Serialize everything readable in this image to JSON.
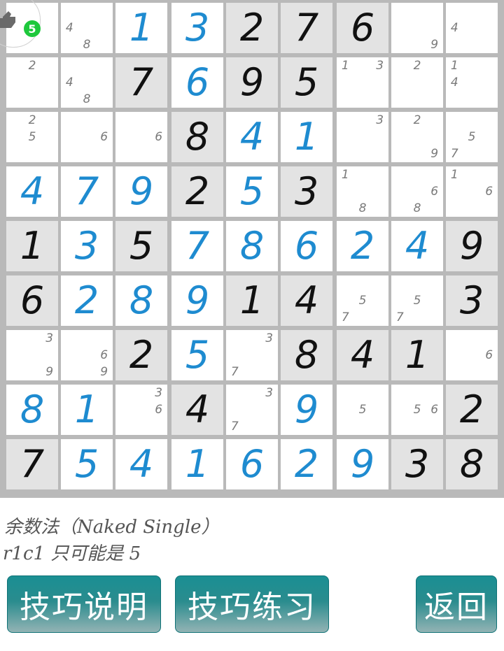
{
  "board": {
    "rows": [
      [
        {
          "v": "",
          "c": [],
          "g": false
        },
        {
          "v": "",
          "c": [
            "4",
            "8"
          ],
          "g": false
        },
        {
          "v": "1",
          "c": [],
          "g": false
        },
        {
          "v": "3",
          "c": [],
          "g": false
        },
        {
          "v": "2",
          "c": [],
          "g": true
        },
        {
          "v": "7",
          "c": [],
          "g": true
        },
        {
          "v": "6",
          "c": [],
          "g": true
        },
        {
          "v": "",
          "c": [
            "9"
          ],
          "g": false
        },
        {
          "v": "",
          "c": [
            "4"
          ],
          "g": false
        }
      ],
      [
        {
          "v": "",
          "c": [
            "2"
          ],
          "g": false
        },
        {
          "v": "",
          "c": [
            "4",
            "8"
          ],
          "g": false
        },
        {
          "v": "7",
          "c": [],
          "g": true
        },
        {
          "v": "6",
          "c": [],
          "g": false
        },
        {
          "v": "9",
          "c": [],
          "g": true
        },
        {
          "v": "5",
          "c": [],
          "g": true
        },
        {
          "v": "",
          "c": [
            "1",
            "3"
          ],
          "g": false
        },
        {
          "v": "",
          "c": [
            "2"
          ],
          "g": false
        },
        {
          "v": "",
          "c": [
            "1",
            "4"
          ],
          "g": false
        }
      ],
      [
        {
          "v": "",
          "c": [
            "2",
            "5"
          ],
          "g": false
        },
        {
          "v": "",
          "c": [
            "6"
          ],
          "g": false
        },
        {
          "v": "",
          "c": [
            "6"
          ],
          "g": false
        },
        {
          "v": "8",
          "c": [],
          "g": true
        },
        {
          "v": "4",
          "c": [],
          "g": false
        },
        {
          "v": "1",
          "c": [],
          "g": false
        },
        {
          "v": "",
          "c": [
            "3"
          ],
          "g": false
        },
        {
          "v": "",
          "c": [
            "2",
            "9"
          ],
          "g": false
        },
        {
          "v": "",
          "c": [
            "5",
            "7"
          ],
          "g": false
        }
      ],
      [
        {
          "v": "4",
          "c": [],
          "g": false
        },
        {
          "v": "7",
          "c": [],
          "g": false
        },
        {
          "v": "9",
          "c": [],
          "g": false
        },
        {
          "v": "2",
          "c": [],
          "g": true
        },
        {
          "v": "5",
          "c": [],
          "g": false
        },
        {
          "v": "3",
          "c": [],
          "g": true
        },
        {
          "v": "",
          "c": [
            "1",
            "8"
          ],
          "g": false
        },
        {
          "v": "",
          "c": [
            "6",
            "8"
          ],
          "g": false
        },
        {
          "v": "",
          "c": [
            "1",
            "6"
          ],
          "g": false
        }
      ],
      [
        {
          "v": "1",
          "c": [],
          "g": true
        },
        {
          "v": "3",
          "c": [],
          "g": false
        },
        {
          "v": "5",
          "c": [],
          "g": true
        },
        {
          "v": "7",
          "c": [],
          "g": false
        },
        {
          "v": "8",
          "c": [],
          "g": false
        },
        {
          "v": "6",
          "c": [],
          "g": false
        },
        {
          "v": "2",
          "c": [],
          "g": false
        },
        {
          "v": "4",
          "c": [],
          "g": false
        },
        {
          "v": "9",
          "c": [],
          "g": true
        }
      ],
      [
        {
          "v": "6",
          "c": [],
          "g": true
        },
        {
          "v": "2",
          "c": [],
          "g": false
        },
        {
          "v": "8",
          "c": [],
          "g": false
        },
        {
          "v": "9",
          "c": [],
          "g": false
        },
        {
          "v": "1",
          "c": [],
          "g": true
        },
        {
          "v": "4",
          "c": [],
          "g": true
        },
        {
          "v": "",
          "c": [
            "5",
            "7"
          ],
          "g": false
        },
        {
          "v": "",
          "c": [
            "5",
            "7"
          ],
          "g": false
        },
        {
          "v": "3",
          "c": [],
          "g": true
        }
      ],
      [
        {
          "v": "",
          "c": [
            "3",
            "9"
          ],
          "g": false
        },
        {
          "v": "",
          "c": [
            "6",
            "9"
          ],
          "g": false
        },
        {
          "v": "2",
          "c": [],
          "g": true
        },
        {
          "v": "5",
          "c": [],
          "g": false
        },
        {
          "v": "",
          "c": [
            "3",
            "7"
          ],
          "g": false
        },
        {
          "v": "8",
          "c": [],
          "g": true
        },
        {
          "v": "4",
          "c": [],
          "g": true
        },
        {
          "v": "1",
          "c": [],
          "g": true
        },
        {
          "v": "",
          "c": [
            "6"
          ],
          "g": false
        }
      ],
      [
        {
          "v": "8",
          "c": [],
          "g": false
        },
        {
          "v": "1",
          "c": [],
          "g": false
        },
        {
          "v": "",
          "c": [
            "3",
            "6"
          ],
          "g": false
        },
        {
          "v": "4",
          "c": [],
          "g": true
        },
        {
          "v": "",
          "c": [
            "3",
            "7"
          ],
          "g": false
        },
        {
          "v": "9",
          "c": [],
          "g": false
        },
        {
          "v": "",
          "c": [
            "5"
          ],
          "g": false
        },
        {
          "v": "",
          "c": [
            "5",
            "6"
          ],
          "g": false
        },
        {
          "v": "2",
          "c": [],
          "g": true
        }
      ],
      [
        {
          "v": "7",
          "c": [],
          "g": true
        },
        {
          "v": "5",
          "c": [],
          "g": false
        },
        {
          "v": "4",
          "c": [],
          "g": false
        },
        {
          "v": "1",
          "c": [],
          "g": false
        },
        {
          "v": "6",
          "c": [],
          "g": false
        },
        {
          "v": "2",
          "c": [],
          "g": false
        },
        {
          "v": "9",
          "c": [],
          "g": false
        },
        {
          "v": "3",
          "c": [],
          "g": true
        },
        {
          "v": "8",
          "c": [],
          "g": true
        }
      ]
    ]
  },
  "hint": {
    "badge": "5",
    "icon": "hint-hand-icon"
  },
  "info": {
    "line1": "余数法（Naked Single）",
    "line2": "r1c1 只可能是 5"
  },
  "buttons": {
    "explain": "技巧说明",
    "practice": "技巧练习",
    "back": "返回"
  },
  "colors": {
    "given_bg": "#e3e3e3",
    "given_digit": "#111111",
    "placed_digit": "#1e8bd0",
    "candidate": "#7a7a7a",
    "button_teal": "#1a8f93",
    "badge_green": "#1ec83c"
  }
}
